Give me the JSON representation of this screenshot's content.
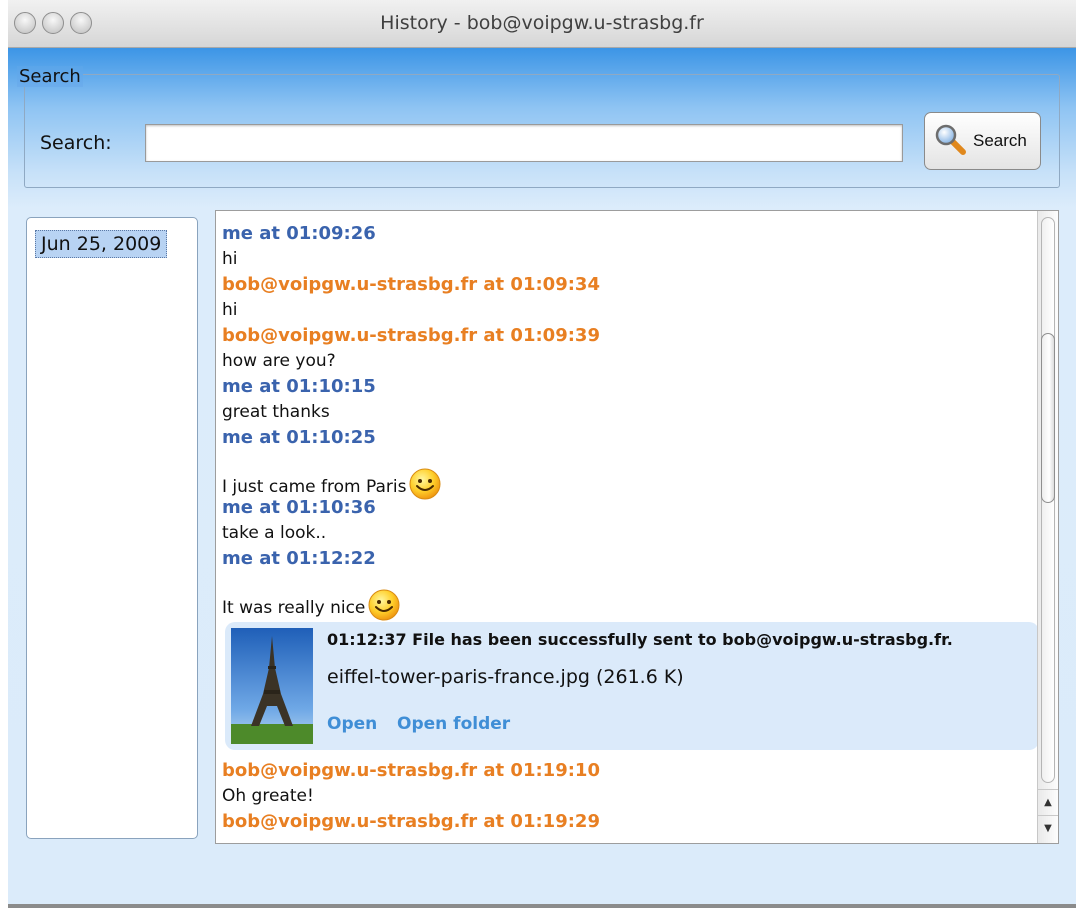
{
  "window": {
    "title": "History - bob@voipgw.u-strasbg.fr"
  },
  "search": {
    "group_label": "Search",
    "label": "Search:",
    "value": "",
    "button_label": "Search",
    "icon": "magnifier-icon"
  },
  "dates": [
    "Jun 25, 2009"
  ],
  "messages": [
    {
      "sender": "me",
      "header": "me at 01:09:26",
      "text": "hi"
    },
    {
      "sender": "bob",
      "header": "bob@voipgw.u-strasbg.fr at 01:09:34",
      "text": "hi"
    },
    {
      "sender": "bob",
      "header": "bob@voipgw.u-strasbg.fr at 01:09:39",
      "text": "how are you?"
    },
    {
      "sender": "me",
      "header": "me at 01:10:15",
      "text": "great thanks"
    },
    {
      "sender": "me",
      "header": "me at 01:10:25",
      "text": "I just came from Paris",
      "emoticon": "smiley-icon"
    },
    {
      "sender": "me",
      "header": "me at 01:10:36",
      "text": "take a look.."
    },
    {
      "sender": "me",
      "header": "me at 01:12:22",
      "text": "It was really nice",
      "emoticon": "smiley-icon"
    },
    {
      "sender": "bob",
      "header": "bob@voipgw.u-strasbg.fr at 01:19:10",
      "text": "Oh greate!"
    },
    {
      "sender": "bob",
      "header": "bob@voipgw.u-strasbg.fr at 01:19:29",
      "text": ""
    }
  ],
  "file_transfer": {
    "status": "01:12:37 File has been successfully sent to bob@voipgw.u-strasbg.fr.",
    "filename": "eiffel-tower-paris-france.jpg (261.6 K)",
    "open_label": "Open",
    "open_folder_label": "Open folder",
    "thumbnail": "eiffel-tower-thumbnail"
  },
  "colors": {
    "me": "#3a63ad",
    "bob": "#e87f22",
    "link": "#3f8ed6",
    "file_bg": "#dbeafa"
  }
}
